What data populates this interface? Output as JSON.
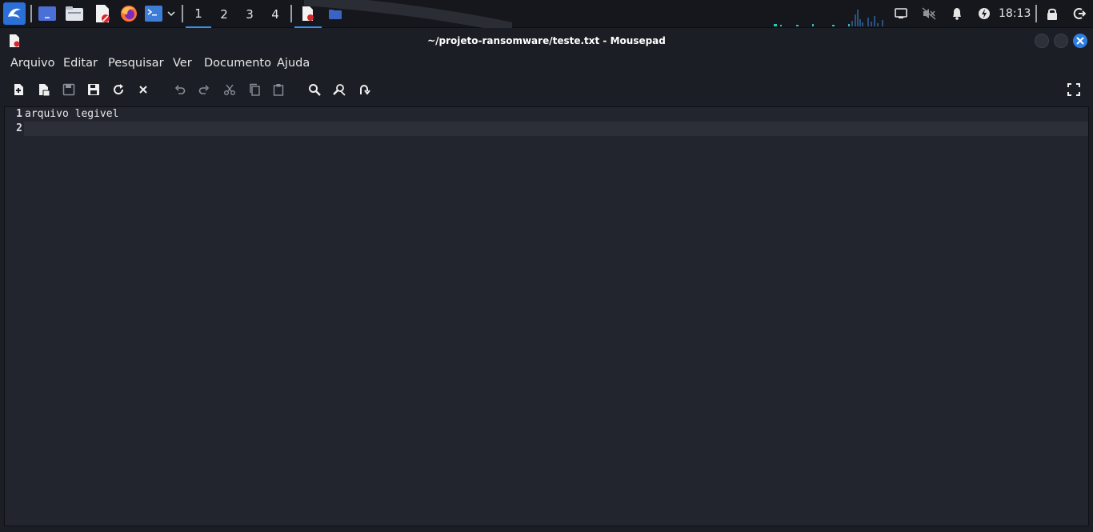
{
  "panel": {
    "launcher_icon": "kali-dragon-icon",
    "apps": [
      "show-desktop-icon",
      "file-manager-icon",
      "text-editor-icon",
      "firefox-icon",
      "terminal-icon"
    ],
    "workspaces": [
      "1",
      "2",
      "3",
      "4"
    ],
    "active_workspace": "1",
    "clock": "18:13",
    "tray_icons": [
      "network-icon",
      "volume-muted-icon",
      "notification-bell-icon",
      "power-icon",
      "lock-icon",
      "logout-icon"
    ]
  },
  "window": {
    "title": "~/projeto-ransomware/teste.txt - Mousepad"
  },
  "menu": {
    "arquivo": "Arquivo",
    "editar": "Editar",
    "pesquisar": "Pesquisar",
    "ver": "Ver",
    "documento": "Documento",
    "ajuda": "Ajuda"
  },
  "toolbar": {
    "icons": [
      "new-document-icon",
      "new-window-icon",
      "save-icon",
      "save-as-icon",
      "reload-icon",
      "close-icon",
      "undo-icon",
      "redo-icon",
      "cut-icon",
      "copy-icon",
      "paste-icon",
      "find-icon",
      "find-replace-icon",
      "go-to-line-icon",
      "fullscreen-icon"
    ]
  },
  "editor": {
    "lines": [
      {
        "number": "1",
        "text": "arquivo legivel"
      },
      {
        "number": "2",
        "text": ""
      }
    ],
    "current_line": 2
  },
  "colors": {
    "accent": "#3a8ee6",
    "close_button": "#2f7de1",
    "editor_bg": "#23252e",
    "window_bg": "#1b1e24"
  }
}
